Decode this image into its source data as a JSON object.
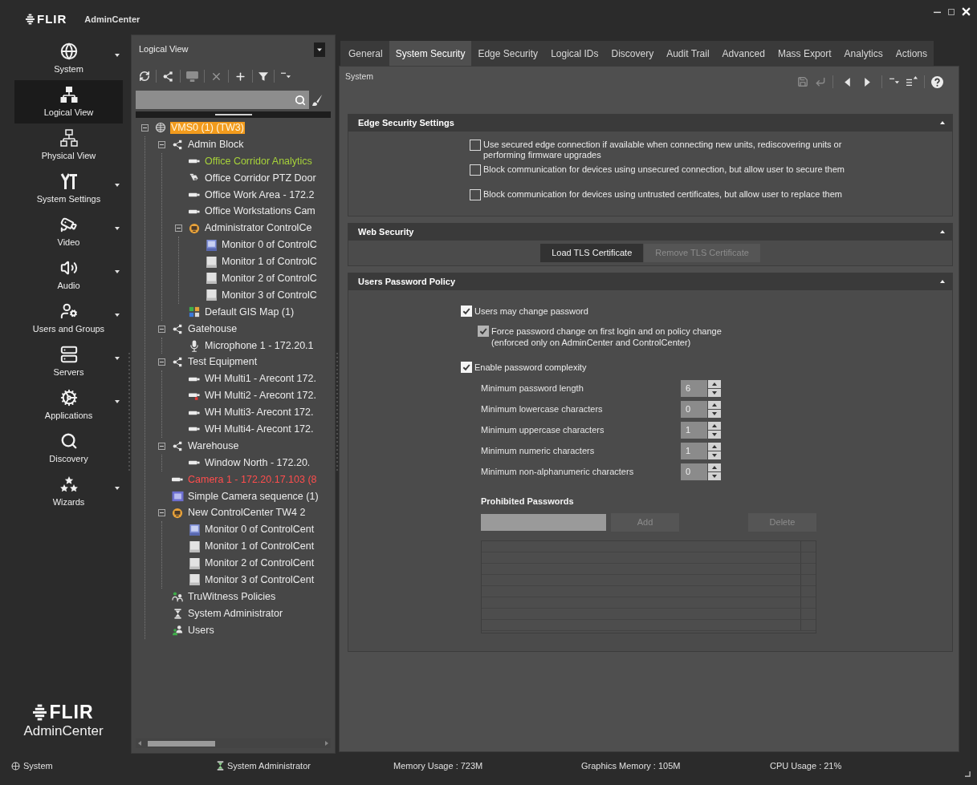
{
  "title_bar": {
    "logo": "FLIR",
    "app_name": "AdminCenter"
  },
  "nav": {
    "items": [
      {
        "label": "System",
        "kind": "system",
        "has_menu": true,
        "selected": false
      },
      {
        "label": "Logical View",
        "kind": "logical",
        "has_menu": false,
        "selected": true
      },
      {
        "label": "Physical View",
        "kind": "physical",
        "has_menu": false,
        "selected": false
      },
      {
        "label": "System Settings",
        "kind": "settings",
        "has_menu": true,
        "selected": false
      },
      {
        "label": "Video",
        "kind": "video",
        "has_menu": true,
        "selected": false
      },
      {
        "label": "Audio",
        "kind": "audio",
        "has_menu": true,
        "selected": false
      },
      {
        "label": "Users and Groups",
        "kind": "users",
        "has_menu": true,
        "selected": false
      },
      {
        "label": "Servers",
        "kind": "servers",
        "has_menu": true,
        "selected": false
      },
      {
        "label": "Applications",
        "kind": "applications",
        "has_menu": true,
        "selected": false
      },
      {
        "label": "Discovery",
        "kind": "discovery",
        "has_menu": false,
        "selected": false
      },
      {
        "label": "Wizards",
        "kind": "wizards",
        "has_menu": true,
        "selected": false
      }
    ],
    "logo": {
      "brand": "FLIR",
      "product": "AdminCenter"
    }
  },
  "tree_panel": {
    "view": "Logical View",
    "tree": [
      {
        "label": "VMS0 (1) (TW3)",
        "kind": "server",
        "selected": true,
        "expanded": true,
        "children": [
          {
            "label": "Admin Block",
            "kind": "group",
            "selected": false,
            "expanded": true,
            "children": [
              {
                "label": "Office Corridor Analytics",
                "kind": "camera",
                "selected": false,
                "color": "#a6d13a"
              },
              {
                "label": "Office Corridor PTZ Door",
                "kind": "ptz",
                "selected": false
              },
              {
                "label": "Office Work Area - 172.2",
                "kind": "camera",
                "selected": false
              },
              {
                "label": "Office Workstations Cam",
                "kind": "camera",
                "selected": false
              },
              {
                "label": "Administrator ControlCe",
                "kind": "workstation",
                "selected": false,
                "expanded": true,
                "children": [
                  {
                    "label": "Monitor 0 of ControlC",
                    "kind": "monitor_active",
                    "selected": false
                  },
                  {
                    "label": "Monitor 1 of ControlC",
                    "kind": "monitor",
                    "selected": false
                  },
                  {
                    "label": "Monitor 2 of ControlC",
                    "kind": "monitor",
                    "selected": false
                  },
                  {
                    "label": "Monitor 3 of ControlC",
                    "kind": "monitor",
                    "selected": false
                  }
                ]
              },
              {
                "label": "Default GIS Map (1)",
                "kind": "map",
                "selected": false
              }
            ]
          },
          {
            "label": "Gatehouse",
            "kind": "group",
            "selected": false,
            "expanded": true,
            "children": [
              {
                "label": "Microphone 1 - 172.20.1",
                "kind": "microphone",
                "selected": false
              }
            ]
          },
          {
            "label": "Test Equipment",
            "kind": "group",
            "selected": false,
            "expanded": true,
            "children": [
              {
                "label": "WH Multi1 - Arecont 172.",
                "kind": "camera",
                "selected": false
              },
              {
                "label": "WH Multi2 - Arecont 172.",
                "kind": "camera_alert",
                "selected": false
              },
              {
                "label": "WH Multi3- Arecont 172.",
                "kind": "camera",
                "selected": false
              },
              {
                "label": "WH Multi4- Arecont 172.",
                "kind": "camera",
                "selected": false
              }
            ]
          },
          {
            "label": "Warehouse",
            "kind": "group",
            "selected": false,
            "expanded": true,
            "children": [
              {
                "label": "Window North - 172.20.",
                "kind": "camera",
                "selected": false
              }
            ]
          },
          {
            "label": "Camera 1 - 172.20.17.103 (8",
            "kind": "camera",
            "selected": false,
            "color": "#ff4d4d"
          },
          {
            "label": "Simple Camera sequence (1)",
            "kind": "sequence",
            "selected": false
          },
          {
            "label": "New ControlCenter TW4 2",
            "kind": "workstation",
            "selected": false,
            "expanded": true,
            "children": [
              {
                "label": "Monitor 0 of ControlCent",
                "kind": "monitor_active",
                "selected": false
              },
              {
                "label": "Monitor 1 of ControlCent",
                "kind": "monitor",
                "selected": false
              },
              {
                "label": "Monitor 2 of ControlCent",
                "kind": "monitor",
                "selected": false
              },
              {
                "label": "Monitor 3 of ControlCent",
                "kind": "monitor",
                "selected": false
              }
            ]
          },
          {
            "label": "TruWitness Policies",
            "kind": "policies",
            "selected": false
          },
          {
            "label": "System Administrator",
            "kind": "user",
            "selected": false
          },
          {
            "label": "Users",
            "kind": "users",
            "selected": false
          }
        ]
      }
    ]
  },
  "tabs": [
    {
      "label": "General",
      "selected": false
    },
    {
      "label": "System Security",
      "selected": true
    },
    {
      "label": "Edge Security",
      "selected": false
    },
    {
      "label": "Logical IDs",
      "selected": false
    },
    {
      "label": "Discovery",
      "selected": false
    },
    {
      "label": "Audit Trail",
      "selected": false
    },
    {
      "label": "Advanced",
      "selected": false
    },
    {
      "label": "Mass Export",
      "selected": false
    },
    {
      "label": "Analytics",
      "selected": false
    },
    {
      "label": "Actions",
      "selected": false
    }
  ],
  "breadcrumb": "System",
  "sections": [
    {
      "title": "Edge Security Settings",
      "kind": "checkboxes",
      "expanded": true,
      "options": [
        {
          "label": "Use secured edge connection if available when connecting new units, rediscovering units or performing firmware upgrades",
          "checked": false
        },
        {
          "label": "Block communication for devices using unsecured connection, but allow user to secure them",
          "checked": false
        },
        {
          "label": "Block communication for devices using untrusted certificates, but allow user to replace them",
          "checked": false
        }
      ]
    },
    {
      "title": "Web Security",
      "kind": "buttons",
      "expanded": true,
      "buttons": [
        {
          "label": "Load TLS Certificate",
          "disabled": false
        },
        {
          "label": "Remove TLS Certificate",
          "disabled": true
        }
      ]
    },
    {
      "title": "Users Password Policy",
      "kind": "policy",
      "expanded": true,
      "options": [
        {
          "label": "Users may change password",
          "checked": true,
          "disabled": false,
          "children": [
            {
              "label": "Force password change on first login and on policy change",
              "note": "(enforced only on AdminCenter and ControlCenter)",
              "checked": true,
              "disabled": true
            }
          ]
        },
        {
          "label": "Enable password complexity",
          "checked": true,
          "disabled": false
        }
      ],
      "spinners": [
        {
          "label": "Minimum password length",
          "value": "6"
        },
        {
          "label": "Minimum lowercase characters",
          "value": "0"
        },
        {
          "label": "Minimum uppercase characters",
          "value": "1"
        },
        {
          "label": "Minimum numeric characters",
          "value": "1"
        },
        {
          "label": "Minimum non-alphanumeric characters",
          "value": "0"
        }
      ],
      "prohibited": {
        "title": "Prohibited Passwords",
        "add": {
          "label": "Add",
          "disabled": true
        },
        "delete": {
          "label": "Delete",
          "disabled": true
        }
      }
    }
  ],
  "status_bar": [
    {
      "kind": "system",
      "text": "System"
    },
    {
      "kind": "user",
      "text": "System Administrator"
    },
    {
      "kind": "metric",
      "text": "Memory Usage : 723M"
    },
    {
      "kind": "metric",
      "text": "Graphics Memory : 105M"
    },
    {
      "kind": "metric",
      "text": "CPU Usage : 21%"
    }
  ]
}
